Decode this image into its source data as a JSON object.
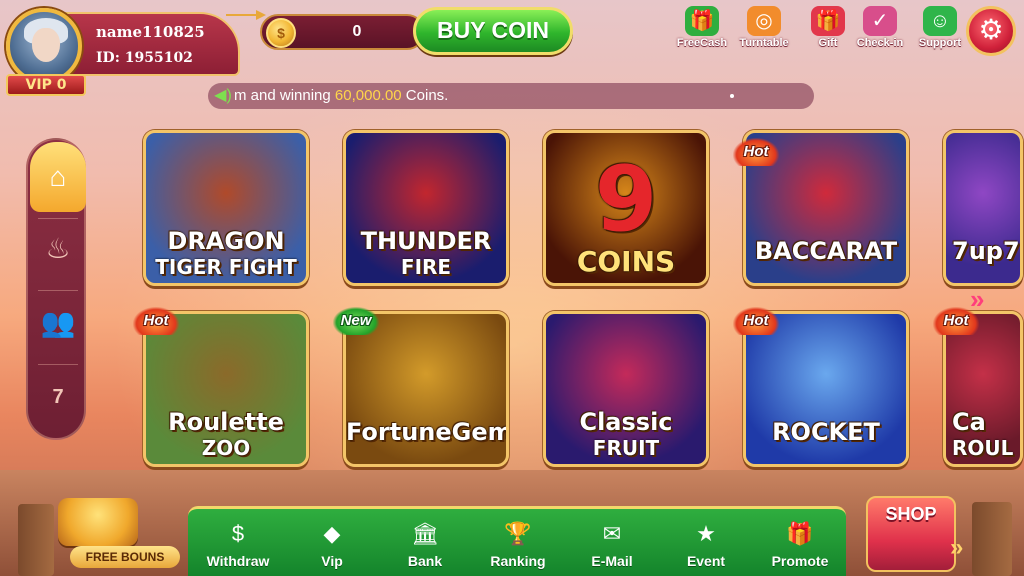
{
  "profile": {
    "name": "name110825",
    "id_label": "ID: 1955102",
    "vip_label": "VIP 0"
  },
  "wallet": {
    "coin_value": "0",
    "coin_symbol": "$",
    "buy_label": "BUY COIN"
  },
  "top_icons": [
    {
      "label": "FreeCash",
      "icon": "freecash-icon",
      "glyph": "🎁",
      "color": "#2fae3f"
    },
    {
      "label": "Turntable",
      "icon": "turntable-icon",
      "glyph": "◎",
      "color": "#f28c2c"
    },
    {
      "label": "Gift",
      "icon": "gift-icon",
      "glyph": "🎁",
      "color": "#e2374b"
    },
    {
      "label": "Check-in",
      "icon": "checkin-icon",
      "glyph": "✓",
      "color": "#d84e8b"
    },
    {
      "label": "Support",
      "icon": "support-icon",
      "glyph": "☺",
      "color": "#2fb54a"
    }
  ],
  "marquee": {
    "prefix": "m and winning ",
    "amount": "60,000.00",
    "suffix": " Coins."
  },
  "left_nav": [
    "home-icon",
    "fire-icon",
    "users-icon",
    "slot-777-icon"
  ],
  "games": [
    {
      "id": "dragon-tiger-fight",
      "line1": "DRAGON",
      "line2": "TIGER FIGHT",
      "badge": "",
      "bg1": "#3b5fa8",
      "bg2": "#b04a2a"
    },
    {
      "id": "thunder-fire",
      "line1": "THUNDER",
      "line2": "FIRE",
      "badge": "",
      "bg1": "#1a1d6e",
      "bg2": "#c2262e"
    },
    {
      "id": "9-coins",
      "line1": "9",
      "line2": "COINS",
      "badge": "",
      "bg1": "#4a1406",
      "bg2": "#d6861a"
    },
    {
      "id": "baccarat",
      "line1": "BACCARAT",
      "line2": "",
      "badge": "Hot",
      "bg1": "#2a3f8a",
      "bg2": "#d02a3b"
    },
    {
      "id": "7up7down",
      "line1": "7up7",
      "line2": "",
      "badge": "",
      "bg1": "#3c2a8e",
      "bg2": "#8f47c4"
    },
    {
      "id": "roulette-zoo",
      "line1": "Roulette",
      "line2": "ZOO",
      "badge": "Hot",
      "bg1": "#5a8a3a",
      "bg2": "#8b6a2a"
    },
    {
      "id": "fortune-gems",
      "line1": "FortuneGems",
      "line2": "",
      "badge": "New",
      "bg1": "#7a4a10",
      "bg2": "#d39b2a"
    },
    {
      "id": "classic-fruit",
      "line1": "Classic",
      "line2": "FRUIT",
      "badge": "",
      "bg1": "#2a1a6e",
      "bg2": "#c42a5a"
    },
    {
      "id": "rocket",
      "line1": "ROCKET",
      "line2": "",
      "badge": "Hot",
      "bg1": "#1f3aa8",
      "bg2": "#6aa8ee"
    },
    {
      "id": "car-roulette",
      "line1": "Ca",
      "line2": "ROUL",
      "badge": "Hot",
      "bg1": "#6a1a2a",
      "bg2": "#c43048"
    }
  ],
  "bottom_nav": [
    {
      "label": "Withdraw",
      "icon": "withdraw-icon",
      "glyph": "$"
    },
    {
      "label": "Vip",
      "icon": "vip-diamond-icon",
      "glyph": "◆"
    },
    {
      "label": "Bank",
      "icon": "bank-icon",
      "glyph": "🏛"
    },
    {
      "label": "Ranking",
      "icon": "ranking-trophy-icon",
      "glyph": "🏆"
    },
    {
      "label": "E-Mail",
      "icon": "email-icon",
      "glyph": "✉"
    },
    {
      "label": "Event",
      "icon": "event-icon",
      "glyph": "★"
    },
    {
      "label": "Promote",
      "icon": "promote-icon",
      "glyph": "🎁"
    }
  ],
  "free_bonus_label": "FREE BOUNS",
  "shop_label": "SHOP",
  "colors": {
    "accent_gold": "#f3c568",
    "bottom_bar_green": "#2fae3f",
    "buy_green": "#2fb52c",
    "marquee_highlight": "#ffd54a"
  }
}
